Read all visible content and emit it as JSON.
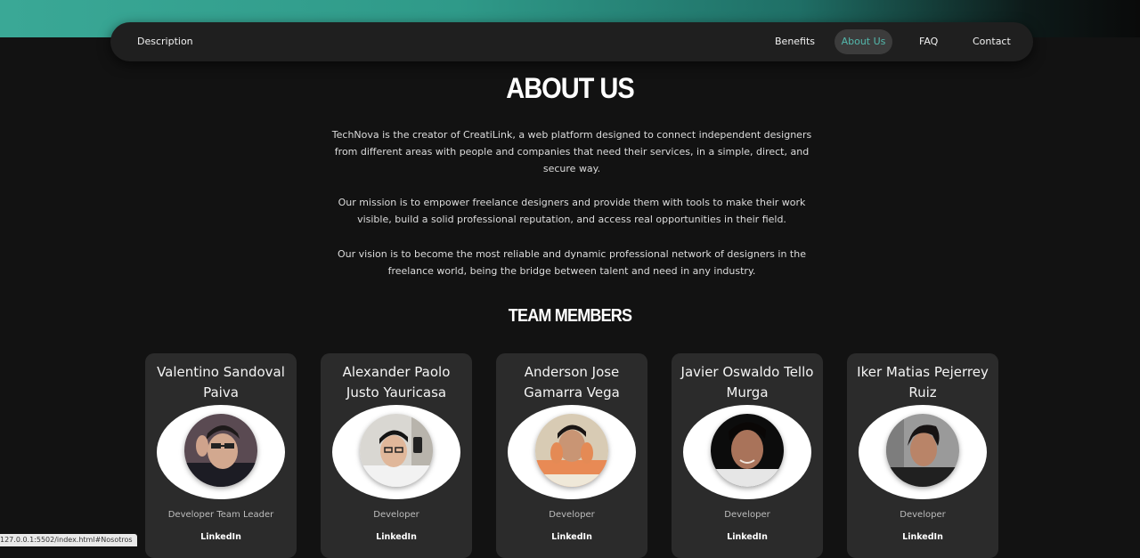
{
  "nav": {
    "brand": "Description",
    "items": [
      "Benefits",
      "About Us",
      "FAQ",
      "Contact"
    ],
    "active": "About Us",
    "accent_color": "#54b9ad"
  },
  "about": {
    "title": "ABOUT US",
    "paragraphs": [
      "TechNova is the creator of CreatiLink, a web platform designed to connect independent designers from different areas with people and companies that need their services, in a simple, direct, and secure way.",
      "Our mission is to empower freelance designers and provide them with tools to make their work visible, build a solid professional reputation, and access real opportunities in their field.",
      "Our vision is to become the most reliable and dynamic professional network of designers in the freelance world, being the bridge between talent and need in any industry."
    ]
  },
  "team": {
    "title": "TEAM MEMBERS",
    "members": [
      {
        "name": "Valentino Sandoval Paiva",
        "role": "Developer Team Leader",
        "link": "LinkedIn"
      },
      {
        "name": "Alexander Paolo Justo Yauricasa",
        "role": "Developer",
        "link": "LinkedIn"
      },
      {
        "name": "Anderson Jose Gamarra Vega",
        "role": "Developer",
        "link": "LinkedIn"
      },
      {
        "name": "Javier Oswaldo Tello Murga",
        "role": "Developer",
        "link": "LinkedIn"
      },
      {
        "name": "Iker Matias Pejerrey Ruiz",
        "role": "Developer",
        "link": "LinkedIn"
      }
    ]
  },
  "status_bar": {
    "url": "127.0.0.1:5502/index.html#Nosotros"
  }
}
